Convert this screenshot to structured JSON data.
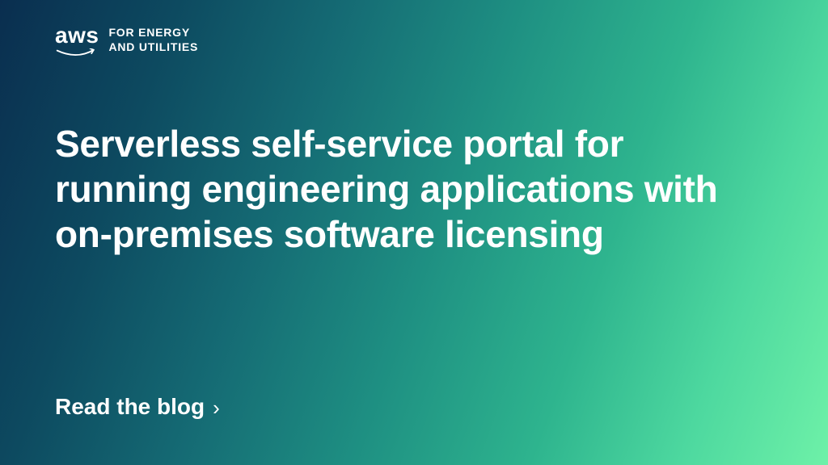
{
  "logo": {
    "brand": "aws",
    "segment_line1": "FOR ENERGY",
    "segment_line2": "AND UTILITIES"
  },
  "headline": "Serverless self-service portal for running engineering applications with on-premises software licensing",
  "cta": {
    "label": "Read the blog",
    "chevron": "›"
  }
}
